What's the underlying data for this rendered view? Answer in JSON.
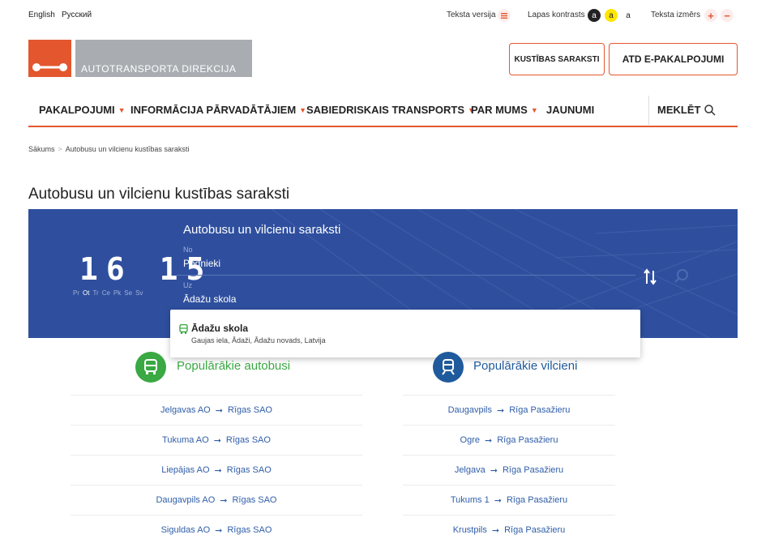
{
  "languages": [
    "English",
    "Русский"
  ],
  "accessibility": {
    "text_version_label": "Teksta versija",
    "contrast_label": "Lapas kontrasts",
    "contrast_options": [
      "a",
      "a",
      "a"
    ],
    "text_size_label": "Teksta izmērs",
    "increase": "+",
    "decrease": "−"
  },
  "logo": {
    "text": "AUTOTRANSPORTA DIREKCIJA"
  },
  "header_buttons": {
    "schedules": "KUSTĪBAS SARAKSTI",
    "eservices": "ATD E-PAKALPOJUMI"
  },
  "nav": {
    "items": [
      "PAKALPOJUMI",
      "INFORMĀCIJA PĀRVADĀTĀJIEM",
      "SABIEDRISKAIS TRANSPORTS",
      "PAR MUMS",
      "JAUNUMI"
    ],
    "search": "MEKLĒT"
  },
  "breadcrumb": {
    "home": "Sākums",
    "separator": ">",
    "current": "Autobusu un vilcienu kustības saraksti"
  },
  "page_title": "Autobusu un vilcienu kustības saraksti",
  "banner": {
    "clock_hours": "16",
    "clock_minutes": "15",
    "days": [
      "Pr",
      "Ot",
      "Tr",
      "Ce",
      "Pk",
      "Se",
      "Sv"
    ],
    "active_day": "Ot",
    "form_title": "Autobusu un vilcienu saraksti",
    "from_label": "No",
    "from_value": "Podnieki",
    "to_label": "Uz",
    "to_value": "Ādažu skola"
  },
  "suggestion": {
    "title": "Ādažu skola",
    "subtitle": "Gaujas iela, Ādaži, Ādažu novads, Latvija"
  },
  "popular_buses": {
    "title": "Populārākie autobusi",
    "color": "#3aa843",
    "routes": [
      {
        "from": "Jelgavas AO",
        "to": "Rīgas SAO"
      },
      {
        "from": "Tukuma AO",
        "to": "Rīgas SAO"
      },
      {
        "from": "Liepājas AO",
        "to": "Rīgas SAO"
      },
      {
        "from": "Daugavpils AO",
        "to": "Rīgas SAO"
      },
      {
        "from": "Siguldas AO",
        "to": "Rīgas SAO"
      }
    ]
  },
  "popular_trains": {
    "title": "Populārākie vilcieni",
    "color": "#1f5a9c",
    "routes": [
      {
        "from": "Daugavpils",
        "to": "Rīga Pasažieru"
      },
      {
        "from": "Ogre",
        "to": "Rīga Pasažieru"
      },
      {
        "from": "Jelgava",
        "to": "Rīga Pasažieru"
      },
      {
        "from": "Tukums 1",
        "to": "Rīga Pasažieru"
      },
      {
        "from": "Krustpils",
        "to": "Rīga Pasažieru"
      }
    ]
  }
}
